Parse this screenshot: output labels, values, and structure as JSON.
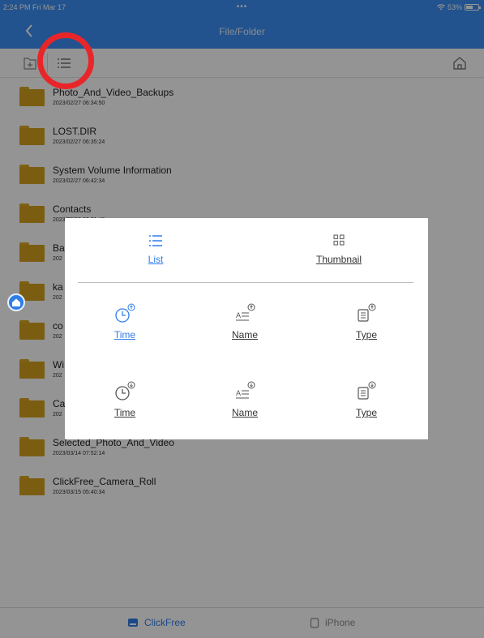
{
  "status_bar": {
    "time_date": "2:24 PM  Fri Mar 17",
    "dots": "•••",
    "battery": "53%"
  },
  "nav": {
    "title": "File/Folder"
  },
  "toolbar": {
    "icons": [
      "new-folder-icon",
      "list-view-icon",
      "home-icon"
    ]
  },
  "files": [
    {
      "name": "Photo_And_Video_Backups",
      "date": "2023/02/27 06:34:50"
    },
    {
      "name": "LOST.DIR",
      "date": "2023/02/27 06:35:24"
    },
    {
      "name": "System Volume Information",
      "date": "2023/02/27 06:42:34"
    },
    {
      "name": "Contacts",
      "date": "2023/03/09 09:31:40"
    },
    {
      "name": "Ba",
      "date": "202"
    },
    {
      "name": "ka",
      "date": "202"
    },
    {
      "name": "co",
      "date": "202"
    },
    {
      "name": "Wi",
      "date": "202"
    },
    {
      "name": "Ca",
      "date": "202"
    },
    {
      "name": "Selected_Photo_And_Video",
      "date": "2023/03/14 07:52:14"
    },
    {
      "name": "ClickFree_Camera_Roll",
      "date": "2023/03/15 05:40:34"
    }
  ],
  "popup": {
    "view_list": "List",
    "view_thumbnail": "Thumbnail",
    "sort_ascending": {
      "time": "Time",
      "name": "Name",
      "type": "Type"
    },
    "sort_descending": {
      "time": "Time",
      "name": "Name",
      "type": "Type"
    }
  },
  "tabbar": {
    "clickfree": "ClickFree",
    "iphone": "iPhone"
  },
  "colors": {
    "accent": "#2f7de9",
    "navbar": "#3d8ff5",
    "folder": "#d4a11f",
    "highlight": "#e8262a"
  }
}
